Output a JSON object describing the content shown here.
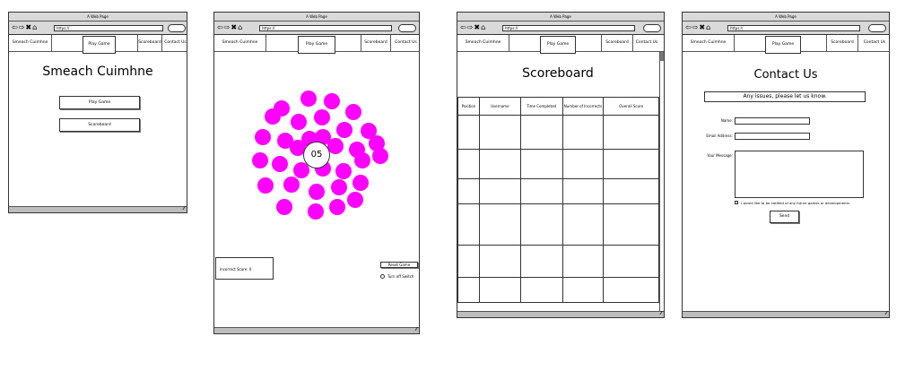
{
  "browser": {
    "title": "A Web Page",
    "url": "https://",
    "nav_icons": "⇦⇨✖⌂"
  },
  "nav": {
    "home": "Smeach Cuimhne",
    "play": "Play Game",
    "scoreboard": "Scoreboard",
    "contact": "Contact Us"
  },
  "home_page": {
    "heading": "Smeach Cuimhne",
    "play_button": "Play Game",
    "scoreboard_button": "Scoreboard"
  },
  "game_page": {
    "countdown": "05",
    "incorrect_label": "Incorrect Score: 0",
    "reset_button": "Reset Game",
    "switch_label": "Turn off Switch"
  },
  "scoreboard_page": {
    "heading": "Scoreboard",
    "columns": [
      "Position",
      "Username",
      "Time Completed",
      "Number of Incorrects",
      "Overall Score"
    ]
  },
  "contact_page": {
    "heading": "Contact Us",
    "banner": "Any issues, please let us know.",
    "name_label": "Name:",
    "email_label": "Email Address:",
    "message_label": "Your Message:",
    "notify_label": "I would like to be notified of any future games or developments",
    "send_button": "Send"
  },
  "colors": {
    "circle": "#ff00ff",
    "chrome": "#d9d9d9"
  }
}
